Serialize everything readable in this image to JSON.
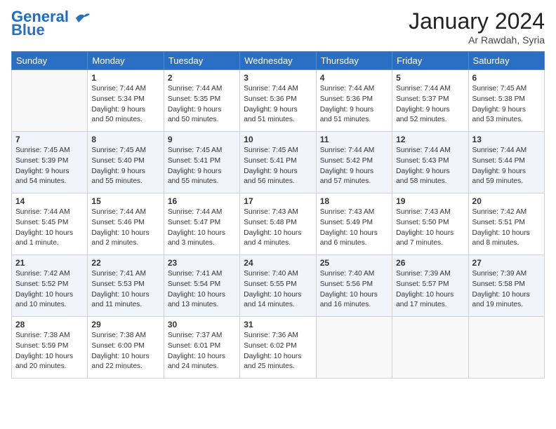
{
  "header": {
    "logo_line1": "General",
    "logo_line2": "Blue",
    "month": "January 2024",
    "location": "Ar Rawdah, Syria"
  },
  "weekdays": [
    "Sunday",
    "Monday",
    "Tuesday",
    "Wednesday",
    "Thursday",
    "Friday",
    "Saturday"
  ],
  "weeks": [
    [
      {
        "day": "",
        "info": ""
      },
      {
        "day": "1",
        "info": "Sunrise: 7:44 AM\nSunset: 5:34 PM\nDaylight: 9 hours\nand 50 minutes."
      },
      {
        "day": "2",
        "info": "Sunrise: 7:44 AM\nSunset: 5:35 PM\nDaylight: 9 hours\nand 50 minutes."
      },
      {
        "day": "3",
        "info": "Sunrise: 7:44 AM\nSunset: 5:36 PM\nDaylight: 9 hours\nand 51 minutes."
      },
      {
        "day": "4",
        "info": "Sunrise: 7:44 AM\nSunset: 5:36 PM\nDaylight: 9 hours\nand 51 minutes."
      },
      {
        "day": "5",
        "info": "Sunrise: 7:44 AM\nSunset: 5:37 PM\nDaylight: 9 hours\nand 52 minutes."
      },
      {
        "day": "6",
        "info": "Sunrise: 7:45 AM\nSunset: 5:38 PM\nDaylight: 9 hours\nand 53 minutes."
      }
    ],
    [
      {
        "day": "7",
        "info": "Sunrise: 7:45 AM\nSunset: 5:39 PM\nDaylight: 9 hours\nand 54 minutes."
      },
      {
        "day": "8",
        "info": "Sunrise: 7:45 AM\nSunset: 5:40 PM\nDaylight: 9 hours\nand 55 minutes."
      },
      {
        "day": "9",
        "info": "Sunrise: 7:45 AM\nSunset: 5:41 PM\nDaylight: 9 hours\nand 55 minutes."
      },
      {
        "day": "10",
        "info": "Sunrise: 7:45 AM\nSunset: 5:41 PM\nDaylight: 9 hours\nand 56 minutes."
      },
      {
        "day": "11",
        "info": "Sunrise: 7:44 AM\nSunset: 5:42 PM\nDaylight: 9 hours\nand 57 minutes."
      },
      {
        "day": "12",
        "info": "Sunrise: 7:44 AM\nSunset: 5:43 PM\nDaylight: 9 hours\nand 58 minutes."
      },
      {
        "day": "13",
        "info": "Sunrise: 7:44 AM\nSunset: 5:44 PM\nDaylight: 9 hours\nand 59 minutes."
      }
    ],
    [
      {
        "day": "14",
        "info": "Sunrise: 7:44 AM\nSunset: 5:45 PM\nDaylight: 10 hours\nand 1 minute."
      },
      {
        "day": "15",
        "info": "Sunrise: 7:44 AM\nSunset: 5:46 PM\nDaylight: 10 hours\nand 2 minutes."
      },
      {
        "day": "16",
        "info": "Sunrise: 7:44 AM\nSunset: 5:47 PM\nDaylight: 10 hours\nand 3 minutes."
      },
      {
        "day": "17",
        "info": "Sunrise: 7:43 AM\nSunset: 5:48 PM\nDaylight: 10 hours\nand 4 minutes."
      },
      {
        "day": "18",
        "info": "Sunrise: 7:43 AM\nSunset: 5:49 PM\nDaylight: 10 hours\nand 6 minutes."
      },
      {
        "day": "19",
        "info": "Sunrise: 7:43 AM\nSunset: 5:50 PM\nDaylight: 10 hours\nand 7 minutes."
      },
      {
        "day": "20",
        "info": "Sunrise: 7:42 AM\nSunset: 5:51 PM\nDaylight: 10 hours\nand 8 minutes."
      }
    ],
    [
      {
        "day": "21",
        "info": "Sunrise: 7:42 AM\nSunset: 5:52 PM\nDaylight: 10 hours\nand 10 minutes."
      },
      {
        "day": "22",
        "info": "Sunrise: 7:41 AM\nSunset: 5:53 PM\nDaylight: 10 hours\nand 11 minutes."
      },
      {
        "day": "23",
        "info": "Sunrise: 7:41 AM\nSunset: 5:54 PM\nDaylight: 10 hours\nand 13 minutes."
      },
      {
        "day": "24",
        "info": "Sunrise: 7:40 AM\nSunset: 5:55 PM\nDaylight: 10 hours\nand 14 minutes."
      },
      {
        "day": "25",
        "info": "Sunrise: 7:40 AM\nSunset: 5:56 PM\nDaylight: 10 hours\nand 16 minutes."
      },
      {
        "day": "26",
        "info": "Sunrise: 7:39 AM\nSunset: 5:57 PM\nDaylight: 10 hours\nand 17 minutes."
      },
      {
        "day": "27",
        "info": "Sunrise: 7:39 AM\nSunset: 5:58 PM\nDaylight: 10 hours\nand 19 minutes."
      }
    ],
    [
      {
        "day": "28",
        "info": "Sunrise: 7:38 AM\nSunset: 5:59 PM\nDaylight: 10 hours\nand 20 minutes."
      },
      {
        "day": "29",
        "info": "Sunrise: 7:38 AM\nSunset: 6:00 PM\nDaylight: 10 hours\nand 22 minutes."
      },
      {
        "day": "30",
        "info": "Sunrise: 7:37 AM\nSunset: 6:01 PM\nDaylight: 10 hours\nand 24 minutes."
      },
      {
        "day": "31",
        "info": "Sunrise: 7:36 AM\nSunset: 6:02 PM\nDaylight: 10 hours\nand 25 minutes."
      },
      {
        "day": "",
        "info": ""
      },
      {
        "day": "",
        "info": ""
      },
      {
        "day": "",
        "info": ""
      }
    ]
  ]
}
